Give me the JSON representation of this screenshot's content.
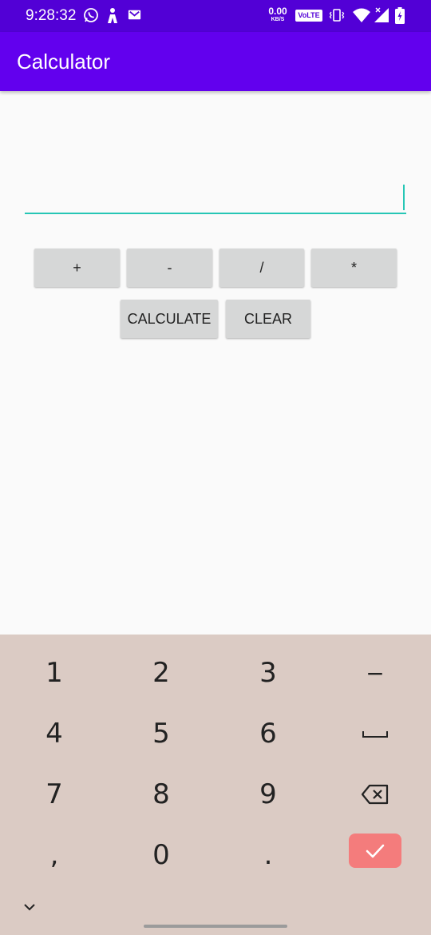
{
  "status_bar": {
    "time": "9:28:32",
    "net_speed_value": "0.00",
    "net_speed_unit": "KB/S",
    "volte_label": "VoLTE",
    "icons": [
      "whatsapp-icon",
      "person-icon",
      "gmail-icon",
      "vibrate-icon",
      "wifi-icon",
      "signal-icon",
      "battery-icon"
    ]
  },
  "app_bar": {
    "title": "Calculator"
  },
  "input": {
    "value": "",
    "placeholder": ""
  },
  "operators": {
    "add": "+",
    "subtract": "-",
    "divide": "/",
    "multiply": "*"
  },
  "actions": {
    "calculate": "CALCULATE",
    "clear": "CLEAR"
  },
  "keyboard": {
    "keys": {
      "k1": "1",
      "k2": "2",
      "k3": "3",
      "k4": "4",
      "k5": "5",
      "k6": "6",
      "k7": "7",
      "k8": "8",
      "k9": "9",
      "k0": "0",
      "comma": ",",
      "period": ".",
      "minus": "−"
    }
  },
  "colors": {
    "status_bar": "#5200d6",
    "app_bar": "#6200ee",
    "accent": "#26c6b5",
    "button_bg": "#d6d7d7",
    "keyboard_bg": "#dbcbc4",
    "done_key": "#f47c7c"
  }
}
